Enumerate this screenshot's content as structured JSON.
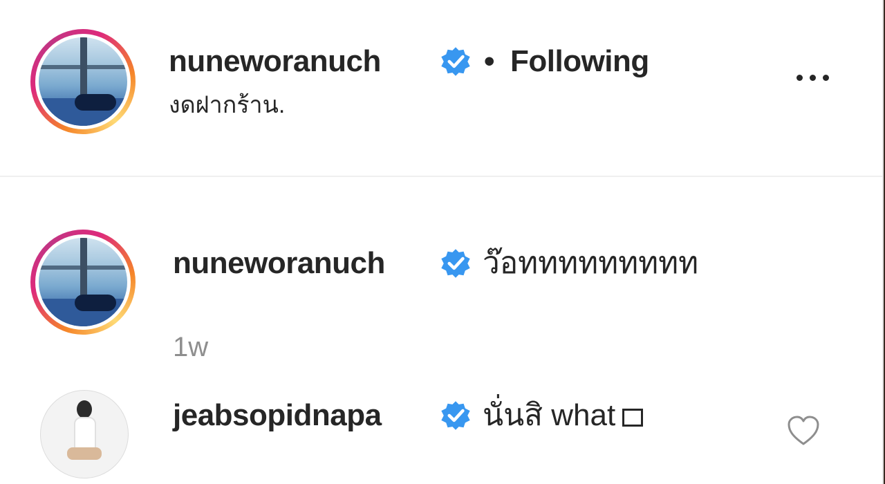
{
  "post_header": {
    "username": "nuneworanuch",
    "separator": "•",
    "follow_status": "Following",
    "caption": "งดฝากร้าน.",
    "more_icon": "more-options-icon"
  },
  "comments": [
    {
      "username": "nuneworanuch",
      "text": "ว๊อททททททททท",
      "time": "1w"
    },
    {
      "username": "jeabsopidnapa",
      "text": "นั่นสิ what",
      "emoji_placeholder": "□"
    }
  ],
  "colors": {
    "verified_blue": "#3897f0",
    "text": "#262626",
    "muted": "#8e8e8e"
  }
}
